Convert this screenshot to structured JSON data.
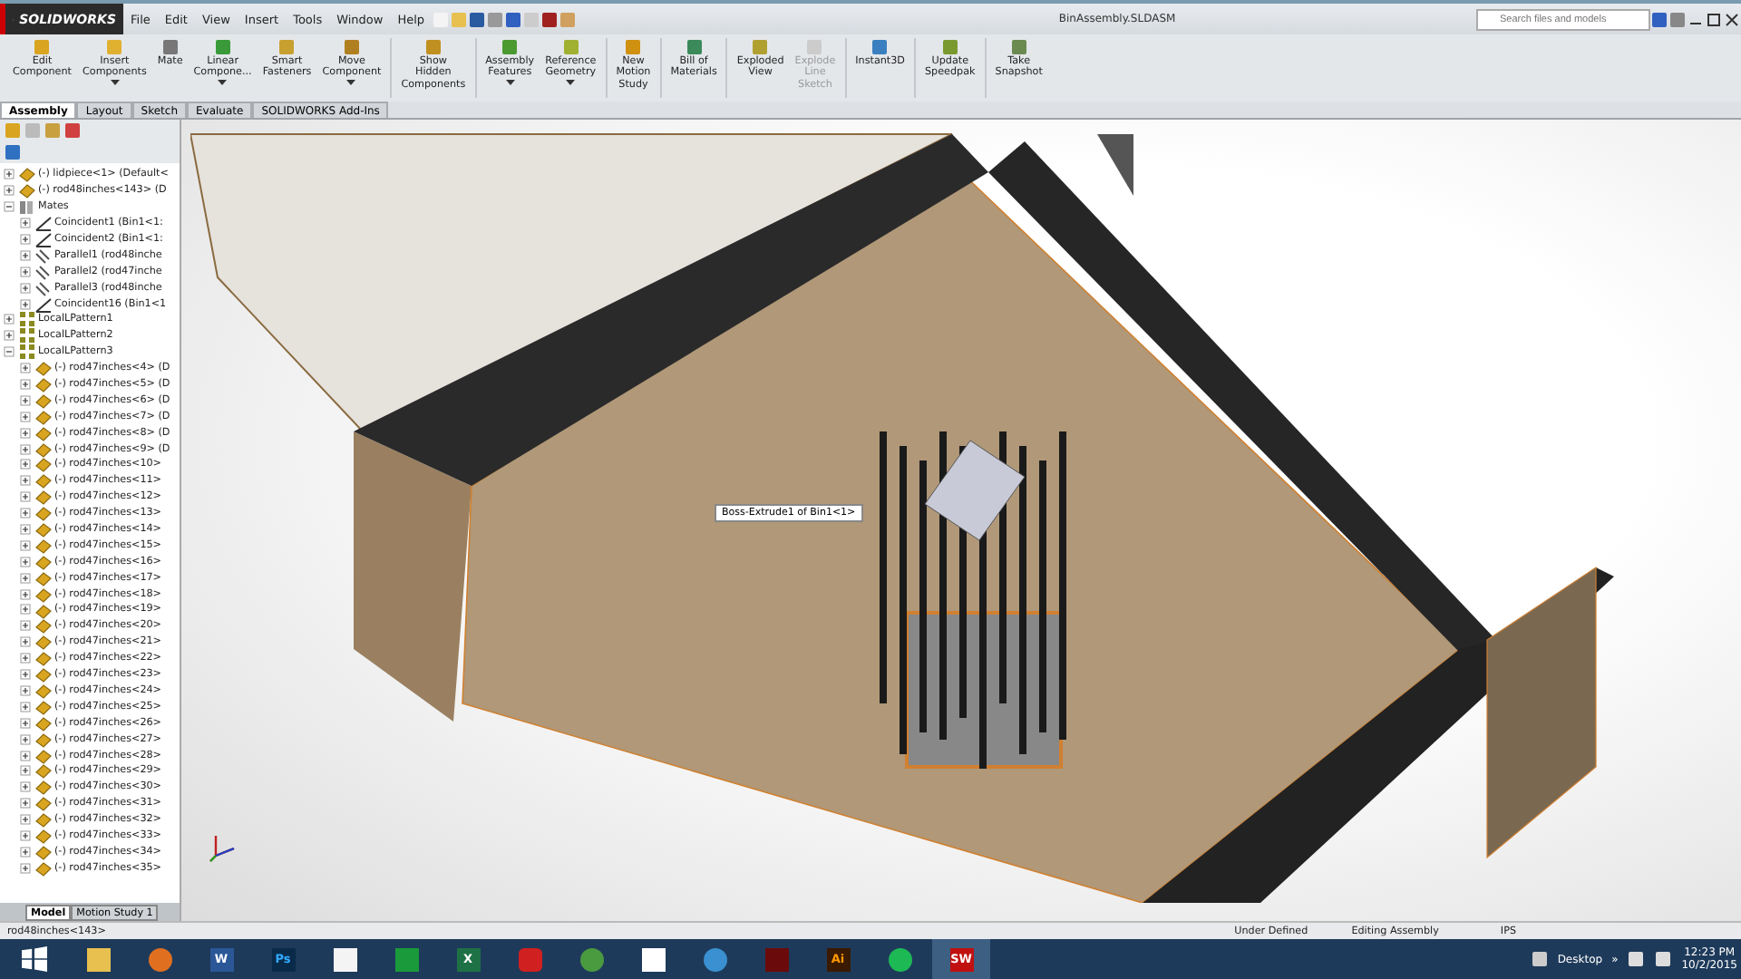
{
  "app_name": "SOLIDWORKS",
  "menu": [
    "File",
    "Edit",
    "View",
    "Insert",
    "Tools",
    "Window",
    "Help"
  ],
  "document_title": "BinAssembly.SLDASM",
  "search": {
    "placeholder": "Search files and models"
  },
  "ribbon": [
    {
      "label": "Edit\nComponent",
      "dropdown": false,
      "disabled": false
    },
    {
      "label": "Insert\nComponents",
      "dropdown": true,
      "disabled": false
    },
    {
      "label": "Mate",
      "dropdown": false,
      "disabled": false
    },
    {
      "label": "Linear\nCompone...",
      "dropdown": true,
      "disabled": false
    },
    {
      "label": "Smart\nFasteners",
      "dropdown": false,
      "disabled": false
    },
    {
      "label": "Move\nComponent",
      "dropdown": true,
      "disabled": false
    },
    {
      "label": "Show\nHidden\nComponents",
      "dropdown": false,
      "disabled": false
    },
    {
      "label": "Assembly\nFeatures",
      "dropdown": true,
      "disabled": false
    },
    {
      "label": "Reference\nGeometry",
      "dropdown": true,
      "disabled": false
    },
    {
      "label": "New\nMotion\nStudy",
      "dropdown": false,
      "disabled": false
    },
    {
      "label": "Bill of\nMaterials",
      "dropdown": false,
      "disabled": false
    },
    {
      "label": "Exploded\nView",
      "dropdown": false,
      "disabled": false
    },
    {
      "label": "Explode\nLine\nSketch",
      "dropdown": false,
      "disabled": true
    },
    {
      "label": "Instant3D",
      "dropdown": false,
      "disabled": false
    },
    {
      "label": "Update\nSpeedpak",
      "dropdown": false,
      "disabled": false
    },
    {
      "label": "Take\nSnapshot",
      "dropdown": false,
      "disabled": false
    }
  ],
  "command_tabs": [
    {
      "label": "Assembly",
      "selected": true
    },
    {
      "label": "Layout",
      "selected": false
    },
    {
      "label": "Sketch",
      "selected": false
    },
    {
      "label": "Evaluate",
      "selected": false
    },
    {
      "label": "SOLIDWORKS Add-Ins",
      "selected": false
    }
  ],
  "tree": [
    {
      "kind": "part",
      "label": "(-) lidpiece<1> (Default<"
    },
    {
      "kind": "part",
      "label": "(-) rod48inches<143> (D"
    },
    {
      "kind": "mates",
      "label": "Mates",
      "expanded": true,
      "children": [
        {
          "kind": "coincident",
          "label": "Coincident1 (Bin1<1:"
        },
        {
          "kind": "coincident",
          "label": "Coincident2 (Bin1<1:"
        },
        {
          "kind": "parallel",
          "label": "Parallel1 (rod48inche"
        },
        {
          "kind": "parallel",
          "label": "Parallel2 (rod47inche"
        },
        {
          "kind": "parallel",
          "label": "Parallel3 (rod48inche"
        },
        {
          "kind": "coincident",
          "label": "Coincident16 (Bin1<1"
        }
      ]
    },
    {
      "kind": "pattern",
      "label": "LocalLPattern1",
      "expanded": false
    },
    {
      "kind": "pattern",
      "label": "LocalLPattern2",
      "expanded": false
    },
    {
      "kind": "pattern",
      "label": "LocalLPattern3",
      "expanded": true,
      "children": [
        {
          "kind": "part",
          "label": "(-) rod47inches<4> (D"
        },
        {
          "kind": "part",
          "label": "(-) rod47inches<5> (D"
        },
        {
          "kind": "part",
          "label": "(-) rod47inches<6> (D"
        },
        {
          "kind": "part",
          "label": "(-) rod47inches<7> (D"
        },
        {
          "kind": "part",
          "label": "(-) rod47inches<8> (D"
        },
        {
          "kind": "part",
          "label": "(-) rod47inches<9> (D"
        },
        {
          "kind": "part",
          "label": "(-) rod47inches<10>"
        },
        {
          "kind": "part",
          "label": "(-) rod47inches<11>"
        },
        {
          "kind": "part",
          "label": "(-) rod47inches<12>"
        },
        {
          "kind": "part",
          "label": "(-) rod47inches<13>"
        },
        {
          "kind": "part",
          "label": "(-) rod47inches<14>"
        },
        {
          "kind": "part",
          "label": "(-) rod47inches<15>"
        },
        {
          "kind": "part",
          "label": "(-) rod47inches<16>"
        },
        {
          "kind": "part",
          "label": "(-) rod47inches<17>"
        },
        {
          "kind": "part",
          "label": "(-) rod47inches<18>"
        },
        {
          "kind": "part",
          "label": "(-) rod47inches<19>"
        },
        {
          "kind": "part",
          "label": "(-) rod47inches<20>"
        },
        {
          "kind": "part",
          "label": "(-) rod47inches<21>"
        },
        {
          "kind": "part",
          "label": "(-) rod47inches<22>"
        },
        {
          "kind": "part",
          "label": "(-) rod47inches<23>"
        },
        {
          "kind": "part",
          "label": "(-) rod47inches<24>"
        },
        {
          "kind": "part",
          "label": "(-) rod47inches<25>"
        },
        {
          "kind": "part",
          "label": "(-) rod47inches<26>"
        },
        {
          "kind": "part",
          "label": "(-) rod47inches<27>"
        },
        {
          "kind": "part",
          "label": "(-) rod47inches<28>"
        },
        {
          "kind": "part",
          "label": "(-) rod47inches<29>"
        },
        {
          "kind": "part",
          "label": "(-) rod47inches<30>"
        },
        {
          "kind": "part",
          "label": "(-) rod47inches<31>"
        },
        {
          "kind": "part",
          "label": "(-) rod47inches<32>"
        },
        {
          "kind": "part",
          "label": "(-) rod47inches<33>"
        },
        {
          "kind": "part",
          "label": "(-) rod47inches<34>"
        },
        {
          "kind": "part",
          "label": "(-) rod47inches<35>"
        }
      ]
    }
  ],
  "bottom_tabs": [
    {
      "label": "Model",
      "selected": true
    },
    {
      "label": "Motion Study 1",
      "selected": false
    }
  ],
  "tooltip": "Boss-Extrude1 of Bin1<1>",
  "status_bar": {
    "selection": "rod48inches<143>",
    "state": "Under Defined",
    "mode": "Editing Assembly",
    "units": "IPS"
  },
  "taskbar": [
    {
      "kind": "explorer"
    },
    {
      "kind": "firefox"
    },
    {
      "kind": "word",
      "label": "W"
    },
    {
      "kind": "photoshop",
      "label": "Ps"
    },
    {
      "kind": "file"
    },
    {
      "kind": "store"
    },
    {
      "kind": "excel",
      "label": "X"
    },
    {
      "kind": "acrobat-cloud"
    },
    {
      "kind": "chrome"
    },
    {
      "kind": "dropbox"
    },
    {
      "kind": "bird"
    },
    {
      "kind": "acrobat"
    },
    {
      "kind": "illustrator",
      "label": "Ai"
    },
    {
      "kind": "spotify"
    },
    {
      "kind": "solidworks",
      "label": "SW",
      "active": true
    }
  ],
  "tray": {
    "toolbar": "Desktop",
    "more": "»",
    "time": "12:23 PM",
    "date": "10/2/2015"
  }
}
